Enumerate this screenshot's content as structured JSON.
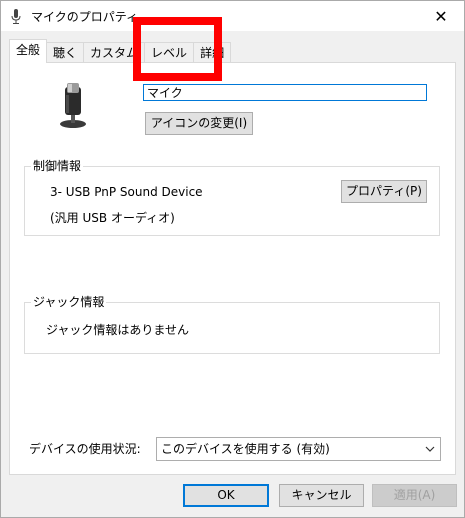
{
  "window": {
    "title": "マイクのプロパティ",
    "close_glyph": "✕"
  },
  "tabs": [
    {
      "label": "全般",
      "active": true
    },
    {
      "label": "聴く",
      "active": false
    },
    {
      "label": "カスタム",
      "active": false
    },
    {
      "label": "レベル",
      "active": false
    },
    {
      "label": "詳細",
      "active": false
    }
  ],
  "general": {
    "name_value": "マイク",
    "change_icon_label": "アイコンの変更(I)",
    "control_group_label": "制御情報",
    "device_name": "3- USB PnP Sound Device",
    "device_driver": "(汎用 USB オーディオ)",
    "properties_label": "プロパティ(P)",
    "jack_group_label": "ジャック情報",
    "jack_text": "ジャック情報はありません",
    "usage_label": "デバイスの使用状況:",
    "usage_value": "このデバイスを使用する (有効)"
  },
  "footer": {
    "ok_label": "OK",
    "cancel_label": "キャンセル",
    "apply_label": "適用(A)"
  },
  "annotation": {
    "highlight_color": "#ff0000"
  },
  "colors": {
    "accent": "#0078d7",
    "background": "#f0f0f0"
  }
}
